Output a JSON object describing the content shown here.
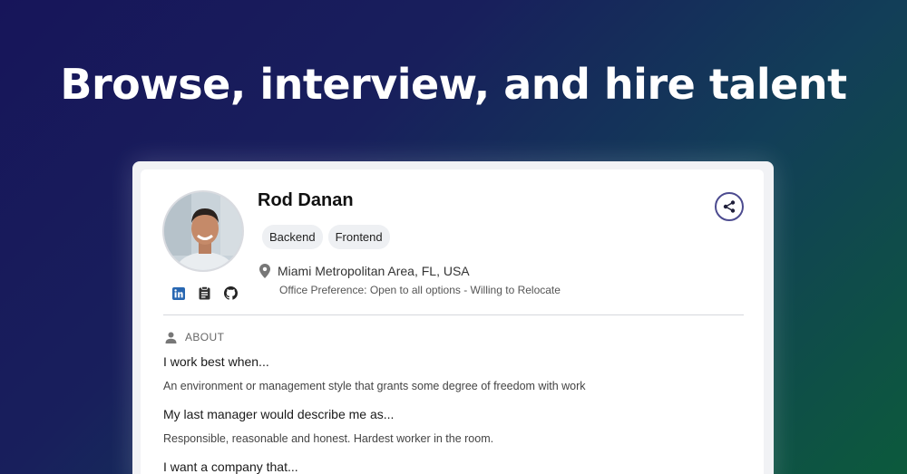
{
  "hero": {
    "title": "Browse, interview, and hire talent"
  },
  "profile": {
    "name": "Rod Danan",
    "tags": [
      "Backend",
      "Frontend"
    ],
    "location": "Miami Metropolitan Area, FL, USA",
    "office_preference": "Office Preference: Open to all options - Willing to Relocate",
    "socials": [
      "linkedin-icon",
      "resume-icon",
      "github-icon"
    ]
  },
  "about": {
    "heading": "ABOUT",
    "items": [
      {
        "question": "I work best when...",
        "answer": "An environment or management style that grants some degree of freedom with work"
      },
      {
        "question": "My last manager would describe me as...",
        "answer": "Responsible, reasonable and honest. Hardest worker in the room."
      },
      {
        "question": "I want a company that...",
        "answer": ""
      }
    ]
  },
  "colors": {
    "accent": "#4c4b8f",
    "linkedin": "#2867b2"
  }
}
